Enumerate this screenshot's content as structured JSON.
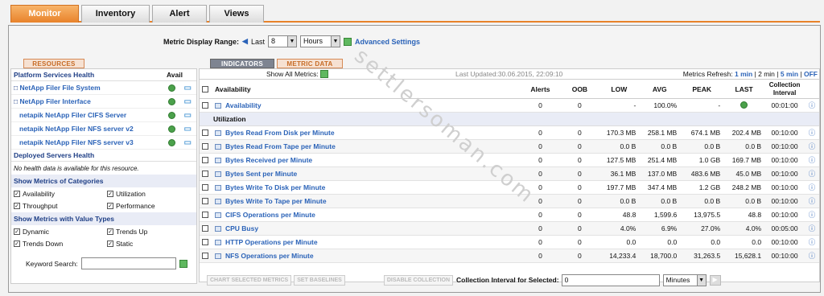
{
  "tabs": [
    "Monitor",
    "Inventory",
    "Alert",
    "Views"
  ],
  "range": {
    "label": "Metric Display Range:",
    "last": "Last",
    "value": "8",
    "unit": "Hours",
    "advanced": "Advanced Settings"
  },
  "subtabs": {
    "resources": "RESOURCES",
    "indicators": "INDICATORS",
    "metric_data": "METRIC DATA"
  },
  "left": {
    "platform_header": "Platform Services Health",
    "avail": "Avail",
    "platform_items": [
      "NetApp Filer File System",
      "NetApp Filer Interface",
      "netapik NetApp Filer CIFS Server",
      "netapik NetApp Filer NFS server v2",
      "netapik NetApp Filer NFS server v3"
    ],
    "deployed_header": "Deployed Servers Health",
    "no_health": "No health data is available for this resource.",
    "categories_header": "Show Metrics of Categories",
    "categories": [
      "Availability",
      "Utilization",
      "Throughput",
      "Performance"
    ],
    "value_types_header": "Show Metrics with Value Types",
    "value_types": [
      "Dynamic",
      "Trends Up",
      "Trends Down",
      "Static"
    ],
    "keyword_label": "Keyword Search:"
  },
  "right": {
    "show_all": "Show All Metrics:",
    "last_updated": "Last Updated:30.06.2015, 22:09:10",
    "refresh_label": "Metrics Refresh:",
    "refresh_1": "1 min",
    "refresh_2": "2 min",
    "refresh_5": "5 min",
    "refresh_off": "OFF",
    "columns": [
      "Availability",
      "Alerts",
      "OOB",
      "LOW",
      "AVG",
      "PEAK",
      "LAST",
      "Collection Interval"
    ],
    "availability_row": {
      "name": "Availability",
      "alerts": "0",
      "oob": "0",
      "low": "-",
      "avg": "100.0%",
      "peak": "-",
      "interval": "00:01:00"
    },
    "utilization_label": "Utilization",
    "rows": [
      {
        "name": "Bytes Read From Disk per Minute",
        "alerts": "0",
        "oob": "0",
        "low": "170.3 MB",
        "avg": "258.1 MB",
        "peak": "674.1 MB",
        "last": "202.4 MB",
        "interval": "00:10:00"
      },
      {
        "name": "Bytes Read From Tape per Minute",
        "alerts": "0",
        "oob": "0",
        "low": "0.0 B",
        "avg": "0.0 B",
        "peak": "0.0 B",
        "last": "0.0 B",
        "interval": "00:10:00"
      },
      {
        "name": "Bytes Received per Minute",
        "alerts": "0",
        "oob": "0",
        "low": "127.5 MB",
        "avg": "251.4 MB",
        "peak": "1.0 GB",
        "last": "169.7 MB",
        "interval": "00:10:00"
      },
      {
        "name": "Bytes Sent per Minute",
        "alerts": "0",
        "oob": "0",
        "low": "36.1 MB",
        "avg": "137.0 MB",
        "peak": "483.6 MB",
        "last": "45.0 MB",
        "interval": "00:10:00"
      },
      {
        "name": "Bytes Write To Disk per Minute",
        "alerts": "0",
        "oob": "0",
        "low": "197.7 MB",
        "avg": "347.4 MB",
        "peak": "1.2 GB",
        "last": "248.2 MB",
        "interval": "00:10:00"
      },
      {
        "name": "Bytes Write To Tape per Minute",
        "alerts": "0",
        "oob": "0",
        "low": "0.0 B",
        "avg": "0.0 B",
        "peak": "0.0 B",
        "last": "0.0 B",
        "interval": "00:10:00"
      },
      {
        "name": "CIFS Operations per Minute",
        "alerts": "0",
        "oob": "0",
        "low": "48.8",
        "avg": "1,599.6",
        "peak": "13,975.5",
        "last": "48.8",
        "interval": "00:10:00"
      },
      {
        "name": "CPU Busy",
        "alerts": "0",
        "oob": "0",
        "low": "4.0%",
        "avg": "6.9%",
        "peak": "27.0%",
        "last": "4.0%",
        "interval": "00:05:00"
      },
      {
        "name": "HTTP Operations per Minute",
        "alerts": "0",
        "oob": "0",
        "low": "0.0",
        "avg": "0.0",
        "peak": "0.0",
        "last": "0.0",
        "interval": "00:10:00"
      },
      {
        "name": "NFS Operations per Minute",
        "alerts": "0",
        "oob": "0",
        "low": "14,233.4",
        "avg": "18,700.0",
        "peak": "31,263.5",
        "last": "15,628.1",
        "interval": "00:10:00"
      }
    ]
  },
  "bottom": {
    "chart_btn": "CHART SELECTED METRICS",
    "baseline_btn": "SET BASELINES",
    "disable_btn": "DISABLE COLLECTION",
    "interval_label": "Collection Interval for Selected:",
    "interval_value": "0",
    "interval_unit": "Minutes"
  },
  "watermark": "settlersoman.com",
  "colors": {
    "accent": "#e8822a",
    "link": "#2b63b8",
    "ok": "#4ba14b"
  }
}
